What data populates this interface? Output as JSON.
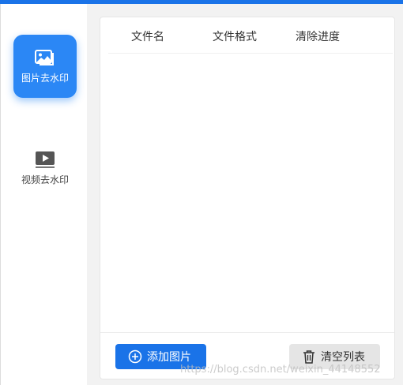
{
  "sidebar": {
    "items": [
      {
        "label": "图片去水印",
        "icon": "image-icon",
        "active": true
      },
      {
        "label": "视频去水印",
        "icon": "video-play-icon",
        "active": false
      }
    ]
  },
  "table": {
    "columns": [
      "文件名",
      "文件格式",
      "清除进度"
    ],
    "rows": []
  },
  "actions": {
    "add_label": "添加图片",
    "add_icon": "plus-circle-icon",
    "clear_label": "清空列表",
    "clear_icon": "trash-icon"
  },
  "watermark": "https://blog.csdn.net/weixin_44148552",
  "colors": {
    "accent": "#1a73e8",
    "active_tab": "#2b87f5",
    "clear_button": "#e5e5e5",
    "background": "#f2f2f2"
  }
}
